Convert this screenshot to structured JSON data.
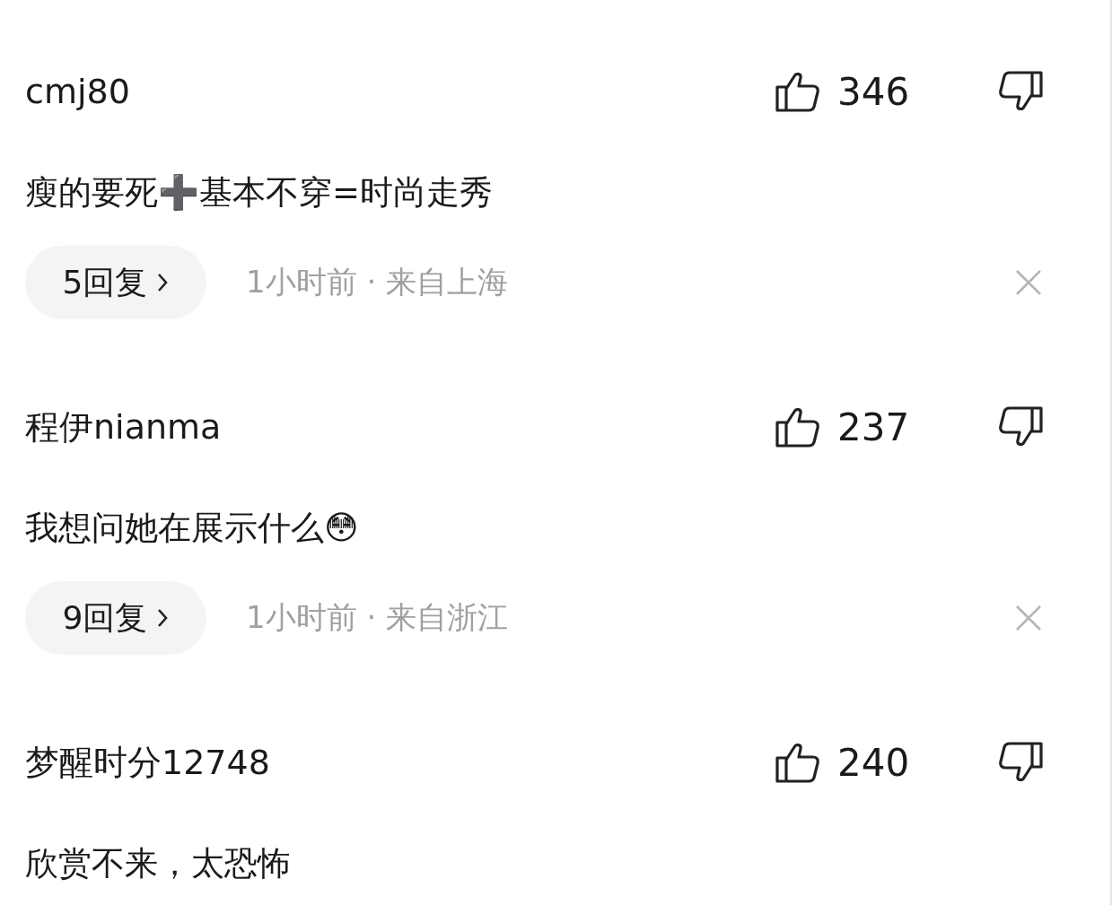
{
  "comments": [
    {
      "user": "cmj80",
      "likes": "346",
      "text": "瘦的要死➕基本不穿=时尚走秀",
      "replies": "5回复",
      "meta": "1小时前 · 来自上海"
    },
    {
      "user": "程伊nianma",
      "likes": "237",
      "text": "我想问她在展示什么😳",
      "replies": "9回复",
      "meta": "1小时前 · 来自浙江"
    },
    {
      "user": "梦醒时分12748",
      "likes": "240",
      "text": "欣赏不来，太恐怖"
    }
  ]
}
